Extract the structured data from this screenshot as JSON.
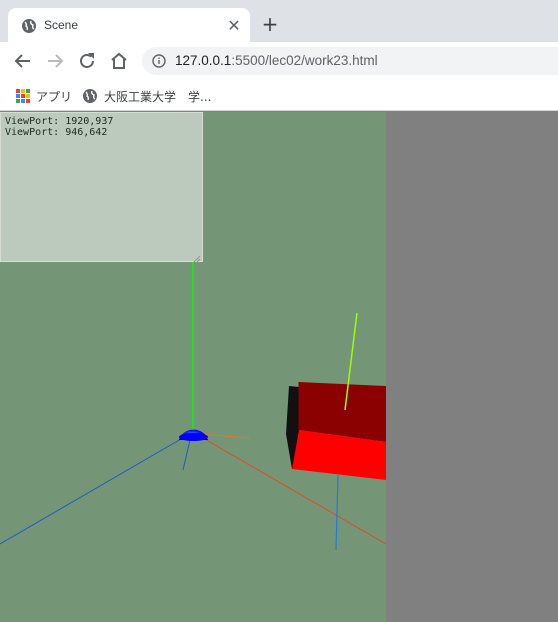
{
  "browser": {
    "tab": {
      "title": "Scene",
      "favicon": "globe-icon",
      "close_glyph": "✕"
    },
    "new_tab_glyph": "+",
    "toolbar": {
      "back_icon": "arrow-left-icon",
      "forward_icon": "arrow-right-icon",
      "reload_icon": "reload-icon",
      "home_icon": "home-icon",
      "info_icon": "info-icon",
      "url_host": "127.0.0.1",
      "url_rest": ":5500/lec02/work23.html"
    },
    "bookmarks": [
      {
        "label": "アプリ",
        "icon": "apps-grid-icon"
      },
      {
        "label": "大阪工業大学　学...",
        "icon": "globe-icon"
      }
    ]
  },
  "scene": {
    "info_lines": [
      "ViewPort: 1920,937",
      "ViewPort: 946,642"
    ],
    "colors": {
      "canvas_background": "#759577",
      "outside_background": "#808080",
      "sphere": "#0000ff",
      "box_red": "#ff0000",
      "box_dark_red": "#8b0000",
      "axis_green": "#00ff00",
      "axis_blue": "#1e5cc8",
      "axis_red": "#e04a2a"
    }
  }
}
